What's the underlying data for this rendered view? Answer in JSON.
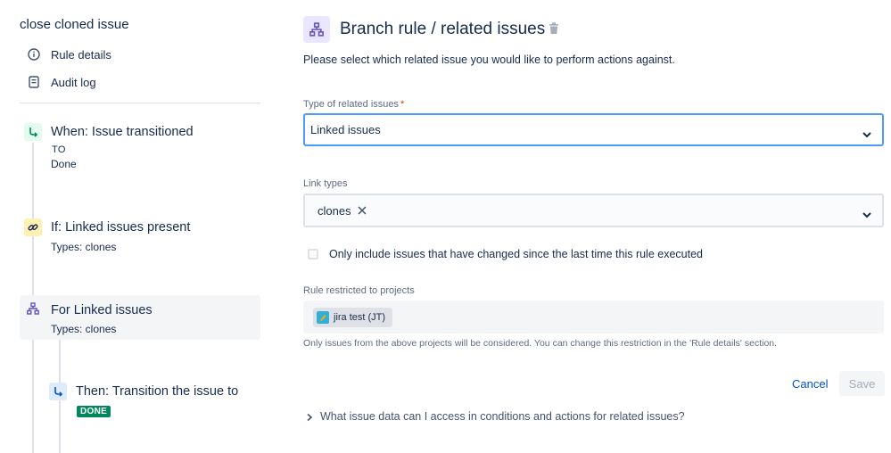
{
  "sidebar": {
    "rule_title": "close cloned issue",
    "links": [
      {
        "label": "Rule details",
        "icon": "info-icon"
      },
      {
        "label": "Audit log",
        "icon": "document-icon"
      }
    ],
    "steps": [
      {
        "title": "When: Issue transitioned",
        "to_label": "TO",
        "sub": "Done",
        "icon": "transition-icon",
        "color": "#e3fcef"
      },
      {
        "title": "If: Linked issues present",
        "sub": "Types: clones",
        "icon": "link-icon",
        "color": "#fffae6"
      },
      {
        "title": "For Linked issues",
        "sub": "Types: clones",
        "icon": "branch-icon",
        "color": "#eae6ff",
        "active": true
      },
      {
        "title": "Then: Transition the issue to",
        "lozenge": "DONE",
        "icon": "transition-icon",
        "color": "#deebff"
      }
    ]
  },
  "main": {
    "title": "Branch rule / related issues",
    "description": "Please select which related issue you would like to perform actions against.",
    "type_field": {
      "label": "Type of related issues",
      "required_mark": "*",
      "value": "Linked issues"
    },
    "link_types": {
      "label": "Link types",
      "tags": [
        "clones"
      ]
    },
    "checkbox_label": "Only include issues that have changed since the last time this rule executed",
    "projects": {
      "label": "Rule restricted to projects",
      "chip": "jira test (JT)",
      "help": "Only issues from the above projects will be considered. You can change this restriction in the 'Rule details' section."
    },
    "cancel_label": "Cancel",
    "save_label": "Save",
    "expander_label": "What issue data can I access in conditions and actions for related issues?"
  },
  "colors": {
    "primary": "#0052cc",
    "focus_border": "#4c9aff",
    "done_lozenge": "#00875a",
    "required": "#de350b"
  }
}
